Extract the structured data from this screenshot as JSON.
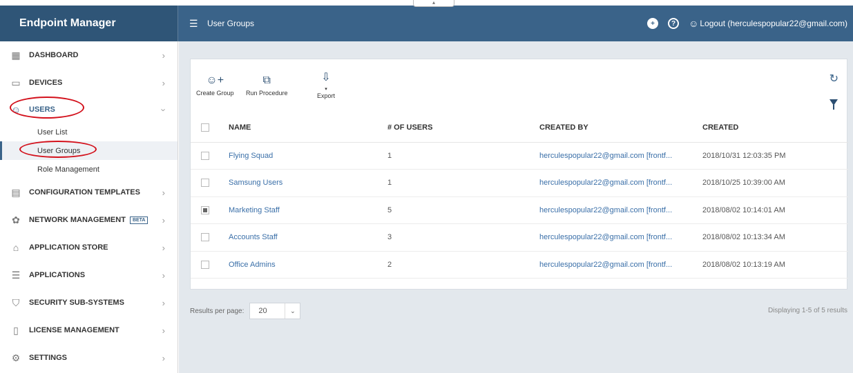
{
  "app": {
    "title": "Endpoint Manager"
  },
  "header": {
    "page_title": "User Groups",
    "menu_icon": "hamburger-icon",
    "logout_label": "Logout (herculespopular22@gmail.com)"
  },
  "sidebar": {
    "items": [
      {
        "label": "DASHBOARD",
        "icon": "dashboard-icon"
      },
      {
        "label": "DEVICES",
        "icon": "devices-icon"
      },
      {
        "label": "USERS",
        "icon": "user-icon"
      },
      {
        "label": "CONFIGURATION TEMPLATES",
        "icon": "template-icon"
      },
      {
        "label": "NETWORK MANAGEMENT",
        "icon": "network-icon",
        "badge": "BETA"
      },
      {
        "label": "APPLICATION STORE",
        "icon": "store-icon"
      },
      {
        "label": "APPLICATIONS",
        "icon": "applications-icon"
      },
      {
        "label": "SECURITY SUB-SYSTEMS",
        "icon": "shield-icon"
      },
      {
        "label": "LICENSE MANAGEMENT",
        "icon": "license-icon"
      },
      {
        "label": "SETTINGS",
        "icon": "gear-icon"
      }
    ],
    "users_sub": [
      "User List",
      "User Groups",
      "Role Management"
    ]
  },
  "toolbar": {
    "create_group": "Create Group",
    "run_procedure": "Run Procedure",
    "export": "Export"
  },
  "table": {
    "headers": [
      "NAME",
      "# OF USERS",
      "CREATED BY",
      "CREATED"
    ],
    "rows": [
      {
        "name": "Flying Squad",
        "users": "1",
        "created_by": "herculespopular22@gmail.com [frontf...",
        "created": "2018/10/31 12:03:35 PM",
        "checked": false
      },
      {
        "name": "Samsung Users",
        "users": "1",
        "created_by": "herculespopular22@gmail.com [frontf...",
        "created": "2018/10/25 10:39:00 AM",
        "checked": false
      },
      {
        "name": "Marketing Staff",
        "users": "5",
        "created_by": "herculespopular22@gmail.com [frontf...",
        "created": "2018/08/02 10:14:01 AM",
        "checked": true
      },
      {
        "name": "Accounts Staff",
        "users": "3",
        "created_by": "herculespopular22@gmail.com [frontf...",
        "created": "2018/08/02 10:13:34 AM",
        "checked": false
      },
      {
        "name": "Office Admins",
        "users": "2",
        "created_by": "herculespopular22@gmail.com [frontf...",
        "created": "2018/08/02 10:13:19 AM",
        "checked": false
      }
    ]
  },
  "pagination": {
    "results_per_page_label": "Results per page:",
    "per_page_value": "20",
    "display_info": "Displaying 1-5 of 5 results"
  },
  "colors": {
    "brand": "#2f5577",
    "header": "#3a6389",
    "highlight_ring": "#d3101b",
    "link": "#3a6fa8"
  }
}
